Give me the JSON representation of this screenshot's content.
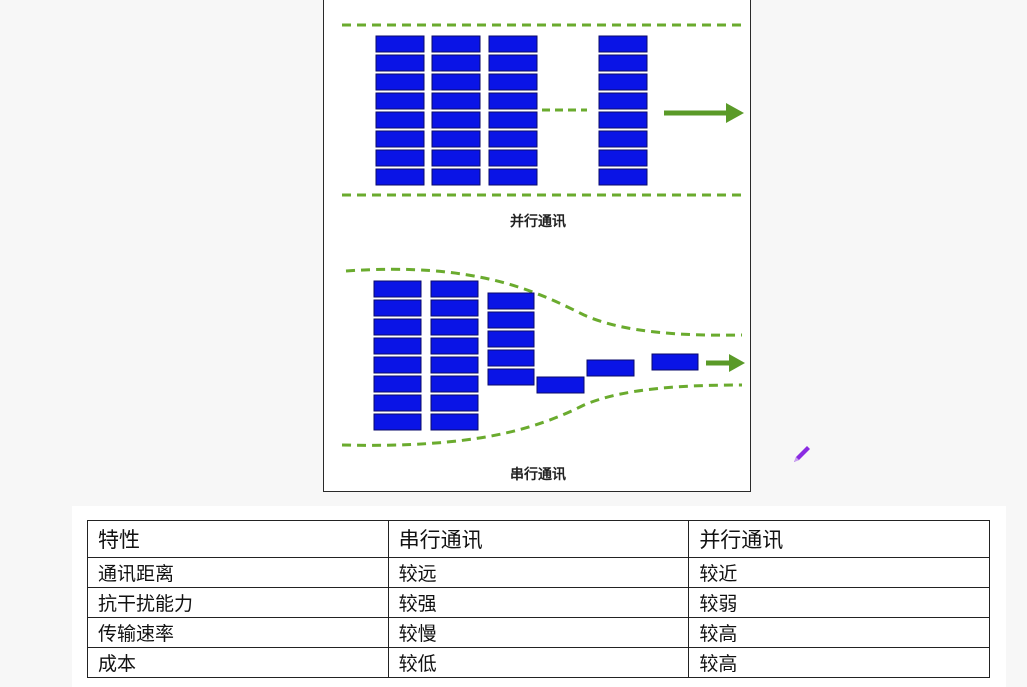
{
  "figure": {
    "parallel_caption": "并行通讯",
    "serial_caption": "串行通讯",
    "colors": {
      "block_fill": "#0a14e6",
      "block_stroke": "#0a0a6a",
      "dash_green": "#6aab2e",
      "arrow_green": "#5a9a28"
    }
  },
  "table": {
    "headers": [
      "特性",
      "串行通讯",
      "并行通讯"
    ],
    "rows": [
      [
        "通讯距离",
        "较远",
        "较近"
      ],
      [
        "抗干扰能力",
        "较强",
        "较弱"
      ],
      [
        "传输速率",
        "较慢",
        "较高"
      ],
      [
        "成本",
        "较低",
        "较高"
      ]
    ]
  },
  "icons": {
    "pencil": "pencil-icon"
  }
}
